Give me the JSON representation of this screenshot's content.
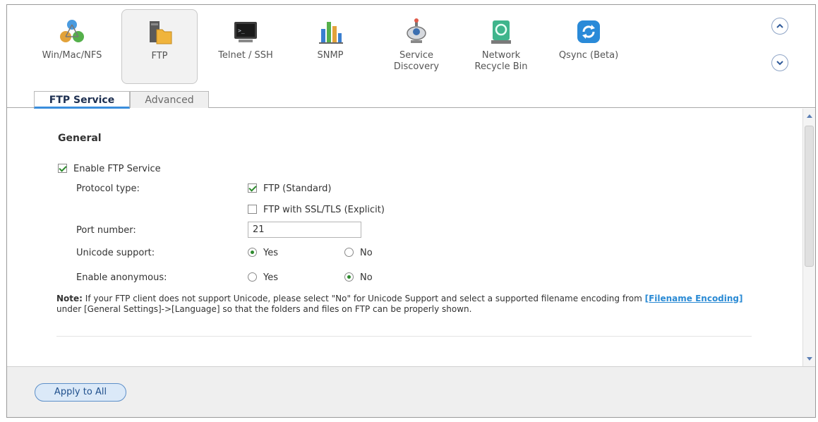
{
  "apps": [
    {
      "label": "Win/Mac/NFS",
      "icon": "win-mac-nfs-icon",
      "selected": false
    },
    {
      "label": "FTP",
      "icon": "ftp-folder-icon",
      "selected": true
    },
    {
      "label": "Telnet / SSH",
      "icon": "terminal-icon",
      "selected": false
    },
    {
      "label": "SNMP",
      "icon": "snmp-chart-icon",
      "selected": false
    },
    {
      "label": "Service Discovery",
      "icon": "service-discovery-icon",
      "selected": false
    },
    {
      "label": "Network Recycle Bin",
      "icon": "recycle-bin-icon",
      "selected": false
    },
    {
      "label": "Qsync (Beta)",
      "icon": "qsync-icon",
      "selected": false
    }
  ],
  "tabs": {
    "active": "FTP Service",
    "inactive": "Advanced"
  },
  "general": {
    "title": "General",
    "enable_ftp": {
      "label": "Enable FTP Service",
      "checked": true
    },
    "protocol": {
      "label": "Protocol type:",
      "standard": {
        "label": "FTP (Standard)",
        "checked": true
      },
      "ssl": {
        "label": "FTP with SSL/TLS (Explicit)",
        "checked": false
      }
    },
    "port": {
      "label": "Port number:",
      "value": "21"
    },
    "unicode": {
      "label": "Unicode support:",
      "yes": "Yes",
      "no": "No",
      "selected": "Yes"
    },
    "anonymous": {
      "label": "Enable anonymous:",
      "yes": "Yes",
      "no": "No",
      "selected": "No"
    }
  },
  "note": {
    "prefix": "Note:",
    "text1": " If your FTP client does not support Unicode, please select \"No\" for Unicode Support and select a supported filename encoding from ",
    "link": "[Filename Encoding]",
    "text2": " under [General Settings]->[Language] so that the folders and files on FTP can be properly shown."
  },
  "footer": {
    "apply_label": "Apply to All"
  },
  "colors": {
    "accent": "#3a8edc",
    "check": "#2d8a2d",
    "link": "#2a8ad4"
  }
}
